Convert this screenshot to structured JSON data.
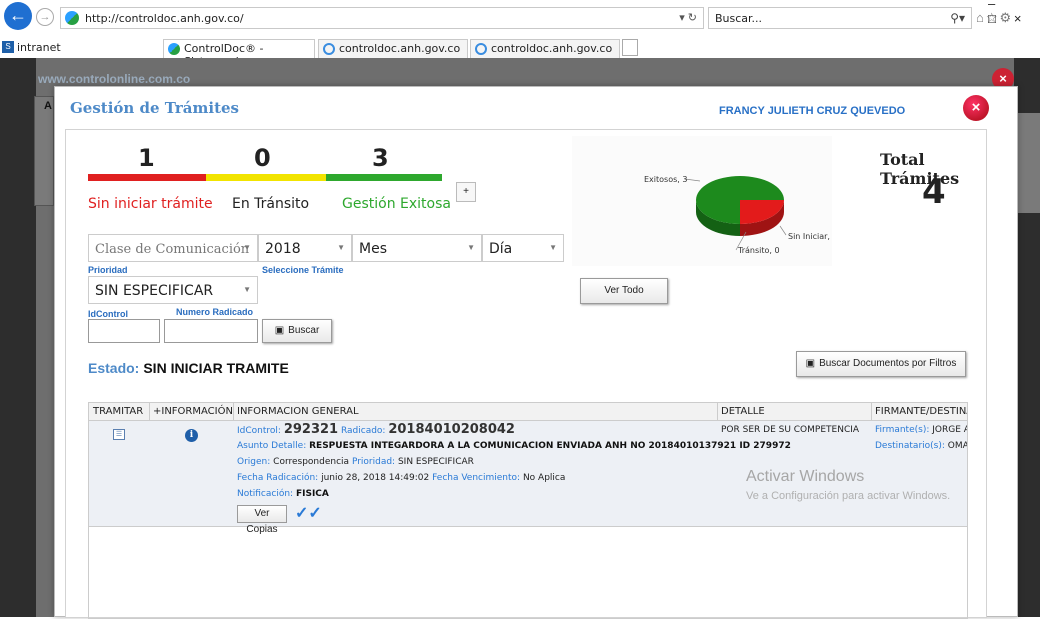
{
  "browser": {
    "url": "http://controldoc.anh.gov.co/",
    "search_placeholder": "Buscar...",
    "favorites": {
      "intranet": "intranet"
    },
    "tabs": [
      {
        "label": "ControlDoc® - Sistema de ...",
        "close": "×"
      },
      {
        "label": "controldoc.anh.gov.co"
      },
      {
        "label": "controldoc.anh.gov.co"
      }
    ]
  },
  "site": {
    "header": "www.controlonline.com.co",
    "letter": "A"
  },
  "modal": {
    "title": "Gestión de Trámites",
    "user": "FRANCY JULIETH CRUZ QUEVEDO",
    "close": "×"
  },
  "counters": {
    "sin_iniciar": {
      "value": "1",
      "label": "Sin iniciar trámite",
      "color": "#e02020"
    },
    "transito": {
      "value": "0",
      "label": "En Tránsito",
      "color": "#f2e400"
    },
    "exitosa": {
      "value": "3",
      "label": "Gestión Exitosa",
      "color": "#2ea82e"
    },
    "expand": "+"
  },
  "chart_data": {
    "type": "pie",
    "labels": [
      "Exitosos, 3",
      "Sin Iniciar, 1",
      "Tránsito, 0"
    ],
    "values": [
      3,
      1,
      0
    ],
    "colors": [
      "#1d8a1d",
      "#e31b1b",
      "#f2e400"
    ]
  },
  "total": {
    "label": "Total Trámites",
    "value": "4"
  },
  "filters": {
    "clase": "Clase de Comunicación",
    "year": "2018",
    "mes": "Mes",
    "dia": "Día",
    "prioridad_label": "Prioridad",
    "prioridad": "SIN ESPECIFICAR",
    "seleccione_label": "Seleccione Trámite",
    "idcontrol_label": "IdControl",
    "radicado_label": "Numero Radicado",
    "buscar": "Buscar",
    "ver_todo": "Ver Todo",
    "buscar_filtros": "Buscar Documentos por Filtros"
  },
  "estado": {
    "label": "Estado:",
    "value": "SIN INICIAR TRAMITE"
  },
  "table": {
    "headers": [
      "TRAMITAR",
      "+INFORMACIÓN",
      "INFORMACION GENERAL",
      "DETALLE",
      "FIRMANTE/DESTINAT..."
    ],
    "row": {
      "idcontrol_k": "IdControl:",
      "idcontrol": "292321",
      "radicado_k": "Radicado:",
      "radicado": "20184010208042",
      "asunto_k": "Asunto Detalle:",
      "asunto": "RESPUESTA INTEGARDORA A LA COMUNICACION ENVIADA ANH NO 20184010137921 ID 279972",
      "origen_k": "Origen:",
      "origen": "Correspondencia",
      "prioridad_k": "Prioridad:",
      "prioridad": "SIN ESPECIFICAR",
      "fecha_rad_k": "Fecha Radicación:",
      "fecha_rad": "junio 28, 2018 14:49:02",
      "fecha_venc_k": "Fecha Vencimiento:",
      "fecha_venc": "No Aplica",
      "notif_k": "Notificación:",
      "notif": "FISICA",
      "ver_copias": "Ver Copias",
      "detalle": "POR SER DE SU COMPETENCIA",
      "firmante_k": "Firmante(s):",
      "firmante": "JORGE ART",
      "destinatario_k": "Destinatario(s):",
      "destinatario": "OMAR A"
    }
  },
  "watermark": {
    "line1": "Activar Windows",
    "line2": "Ve a Configuración para activar Windows."
  }
}
